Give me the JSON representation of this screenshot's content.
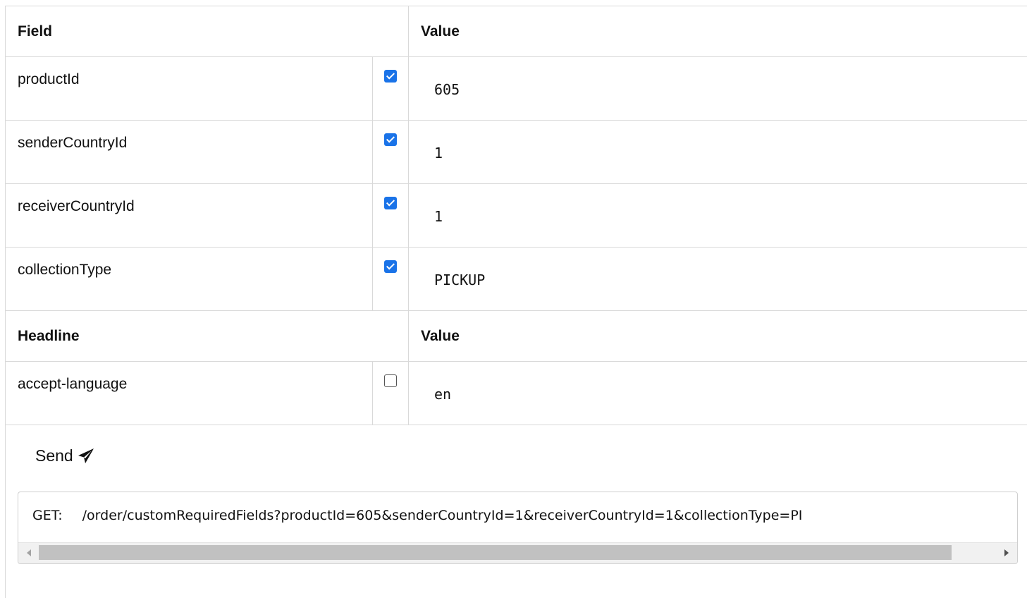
{
  "fields_header": {
    "label": "Field",
    "value": "Value"
  },
  "fields": [
    {
      "name": "productId",
      "checked": true,
      "value": "605"
    },
    {
      "name": "senderCountryId",
      "checked": true,
      "value": "1"
    },
    {
      "name": "receiverCountryId",
      "checked": true,
      "value": "1"
    },
    {
      "name": "collectionType",
      "checked": true,
      "value": "PICKUP"
    }
  ],
  "headlines_header": {
    "label": "Headline",
    "value": "Value"
  },
  "headlines": [
    {
      "name": "accept-language",
      "checked": false,
      "value": "en"
    }
  ],
  "send": {
    "label": "Send",
    "icon": "paper-plane-icon"
  },
  "request": {
    "method": "GET:",
    "url": "/order/customRequiredFields?productId=605&senderCountryId=1&receiverCountryId=1&collectionType=PI"
  },
  "colors": {
    "checkbox_accent": "#1a73e8",
    "border": "#d9d9d9"
  }
}
